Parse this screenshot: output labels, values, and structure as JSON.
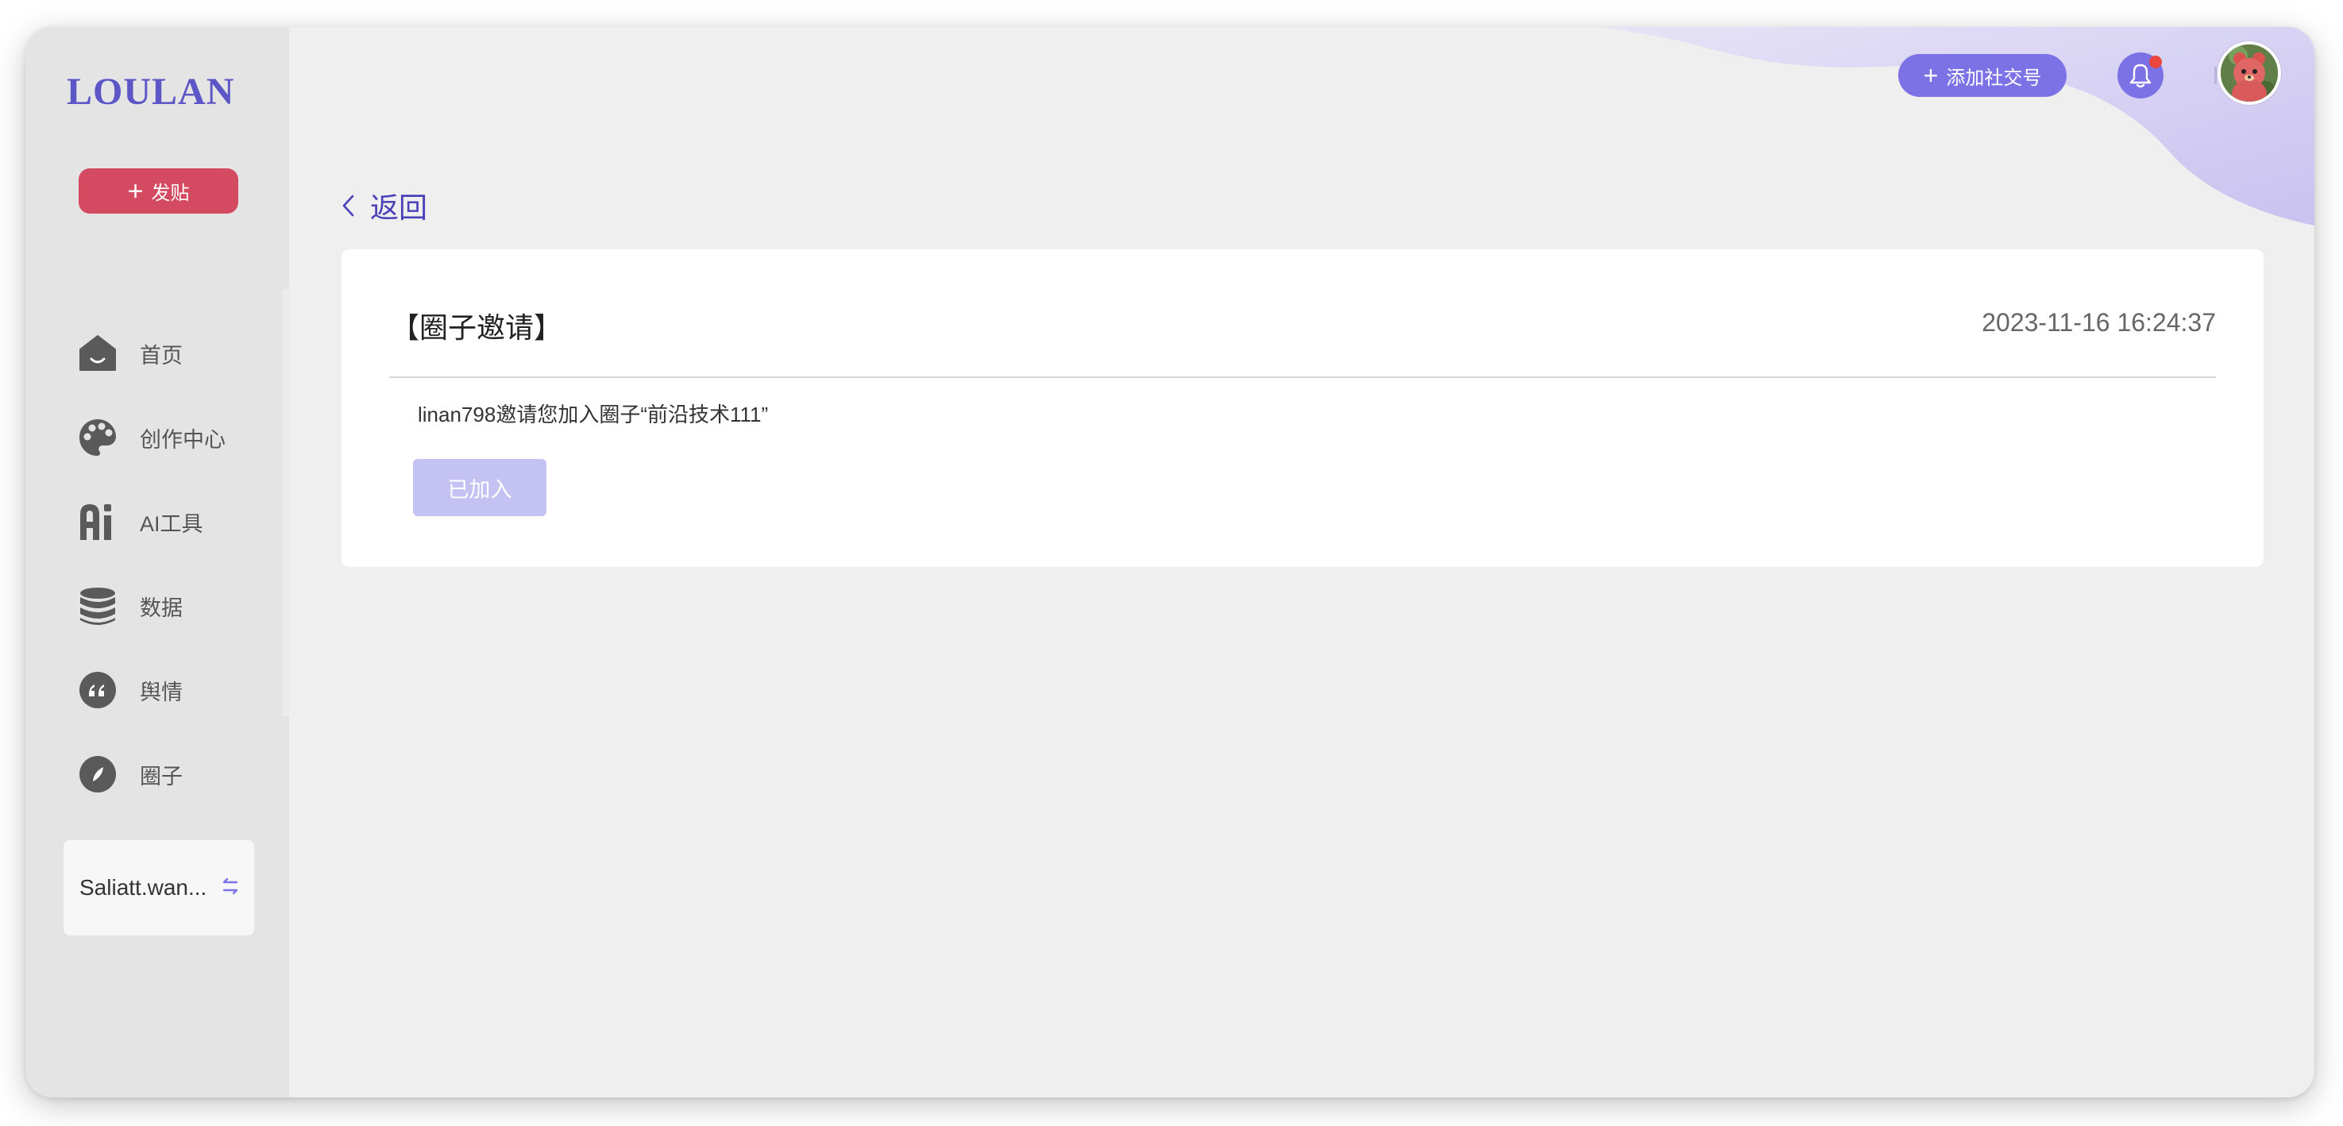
{
  "brand": {
    "logo_text": "LOULAN"
  },
  "sidebar": {
    "post_button": {
      "icon": "plus-icon",
      "label": "发贴"
    },
    "items": [
      {
        "icon": "home-icon",
        "label": "首页"
      },
      {
        "icon": "palette-icon",
        "label": "创作中心"
      },
      {
        "icon": "ai-icon",
        "label": "AI工具"
      },
      {
        "icon": "database-icon",
        "label": "数据"
      },
      {
        "icon": "quote-icon",
        "label": "舆情"
      },
      {
        "icon": "compass-icon",
        "label": "圈子"
      }
    ],
    "account": {
      "name": "Saliatt.wan...",
      "icon": "swap-icon"
    }
  },
  "header": {
    "add_social_button": {
      "icon": "plus-icon",
      "label": "添加社交号"
    },
    "notification": {
      "icon": "bell-icon",
      "has_unread": true
    },
    "avatar": {
      "icon": "avatar"
    }
  },
  "page": {
    "back_label": "返回",
    "notice": {
      "title": "【圈子邀请】",
      "time": "2023-11-16 16:24:37",
      "message": "linan798邀请您加入圈子“前沿技术111”",
      "status_button": "已加入"
    }
  },
  "colors": {
    "accent": "#7c72e6",
    "brand": "#5d56c7",
    "post_button": "#d44a60",
    "joined_button": "#c4c1f3",
    "notification_dot": "#e8463f"
  }
}
